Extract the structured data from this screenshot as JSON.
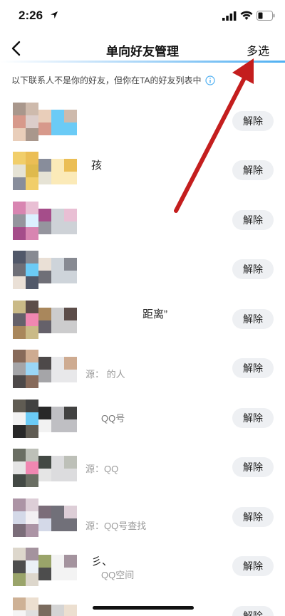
{
  "status": {
    "time": "2:26"
  },
  "nav": {
    "title": "单向好友管理",
    "action": "多选"
  },
  "notice": {
    "text": "以下联系人不是你的好友，但你在TA的好友列表中"
  },
  "remove_label": "解除",
  "rows": [
    {
      "text": "",
      "sub": ""
    },
    {
      "text": "孩",
      "sub": ""
    },
    {
      "text": "",
      "sub": ""
    },
    {
      "text": "",
      "sub": ""
    },
    {
      "text": "距离”",
      "sub": ""
    },
    {
      "text": "",
      "sub": "源：                的人"
    },
    {
      "text": "",
      "sub": "QQ号"
    },
    {
      "text": "",
      "sub": "源：QQ"
    },
    {
      "text": "",
      "sub": "源：QQ号查找"
    },
    {
      "text": "彡、",
      "sub": "QQ空间"
    },
    {
      "text": "",
      "sub": ""
    }
  ],
  "colors": {
    "accent": "#4fb0f2",
    "arrow": "#c41e1e",
    "button_bg": "#eef0f3"
  },
  "icons": [
    "location-icon",
    "signal-icon",
    "wifi-icon",
    "battery-icon",
    "back-icon",
    "info-icon",
    "arrow-annotation"
  ]
}
